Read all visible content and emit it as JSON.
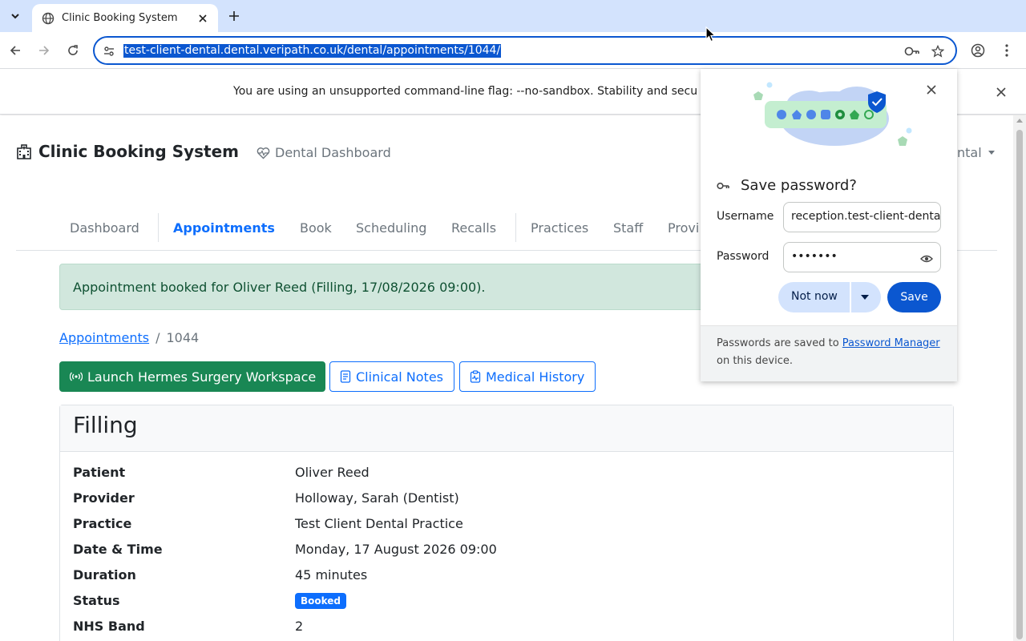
{
  "browser": {
    "tab_title": "Clinic Booking System",
    "url": "test-client-dental.dental.veripath.co.uk/dental/appointments/1044/"
  },
  "infobar": {
    "text": "You are using an unsupported command-line flag: --no-sandbox. Stability and secu"
  },
  "header": {
    "brand": "Clinic Booking System",
    "subbrand": "Dental Dashboard",
    "user_menu": "ntal"
  },
  "nav": {
    "items": [
      "Dashboard",
      "Appointments",
      "Book",
      "Scheduling",
      "Recalls",
      "Practices",
      "Staff",
      "Provi"
    ],
    "active": "Appointments"
  },
  "alert": {
    "text": "Appointment booked for Oliver Reed (Filling, 17/08/2026 09:00)."
  },
  "breadcrumb": {
    "parent": "Appointments",
    "separator": "/",
    "current": "1044"
  },
  "actions": {
    "launch": "Launch Hermes Surgery Workspace",
    "notes": "Clinical Notes",
    "history": "Medical History"
  },
  "appointment": {
    "title": "Filling",
    "rows": [
      {
        "label": "Patient",
        "value": "Oliver Reed"
      },
      {
        "label": "Provider",
        "value": "Holloway, Sarah (Dentist)"
      },
      {
        "label": "Practice",
        "value": "Test Client Dental Practice"
      },
      {
        "label": "Date & Time",
        "value": "Monday, 17 August 2026 09:00"
      },
      {
        "label": "Duration",
        "value": "45 minutes"
      },
      {
        "label": "Status",
        "value": "Booked"
      },
      {
        "label": "NHS Band",
        "value": "2"
      }
    ]
  },
  "password_bubble": {
    "title": "Save password?",
    "username_label": "Username",
    "username_value": "reception.test-client-dental",
    "password_label": "Password",
    "password_value": "•••••••",
    "not_now": "Not now",
    "save": "Save",
    "footer_prefix": "Passwords are saved to",
    "footer_link": "Password Manager",
    "footer_suffix": "on this device."
  },
  "colors": {
    "primary": "#0d6efd",
    "success": "#198754",
    "alert_bg": "#d1e7dd",
    "alert_text": "#0f5132",
    "chrome_accent": "#0b57d0",
    "tabstrip": "#d3e3fd"
  }
}
